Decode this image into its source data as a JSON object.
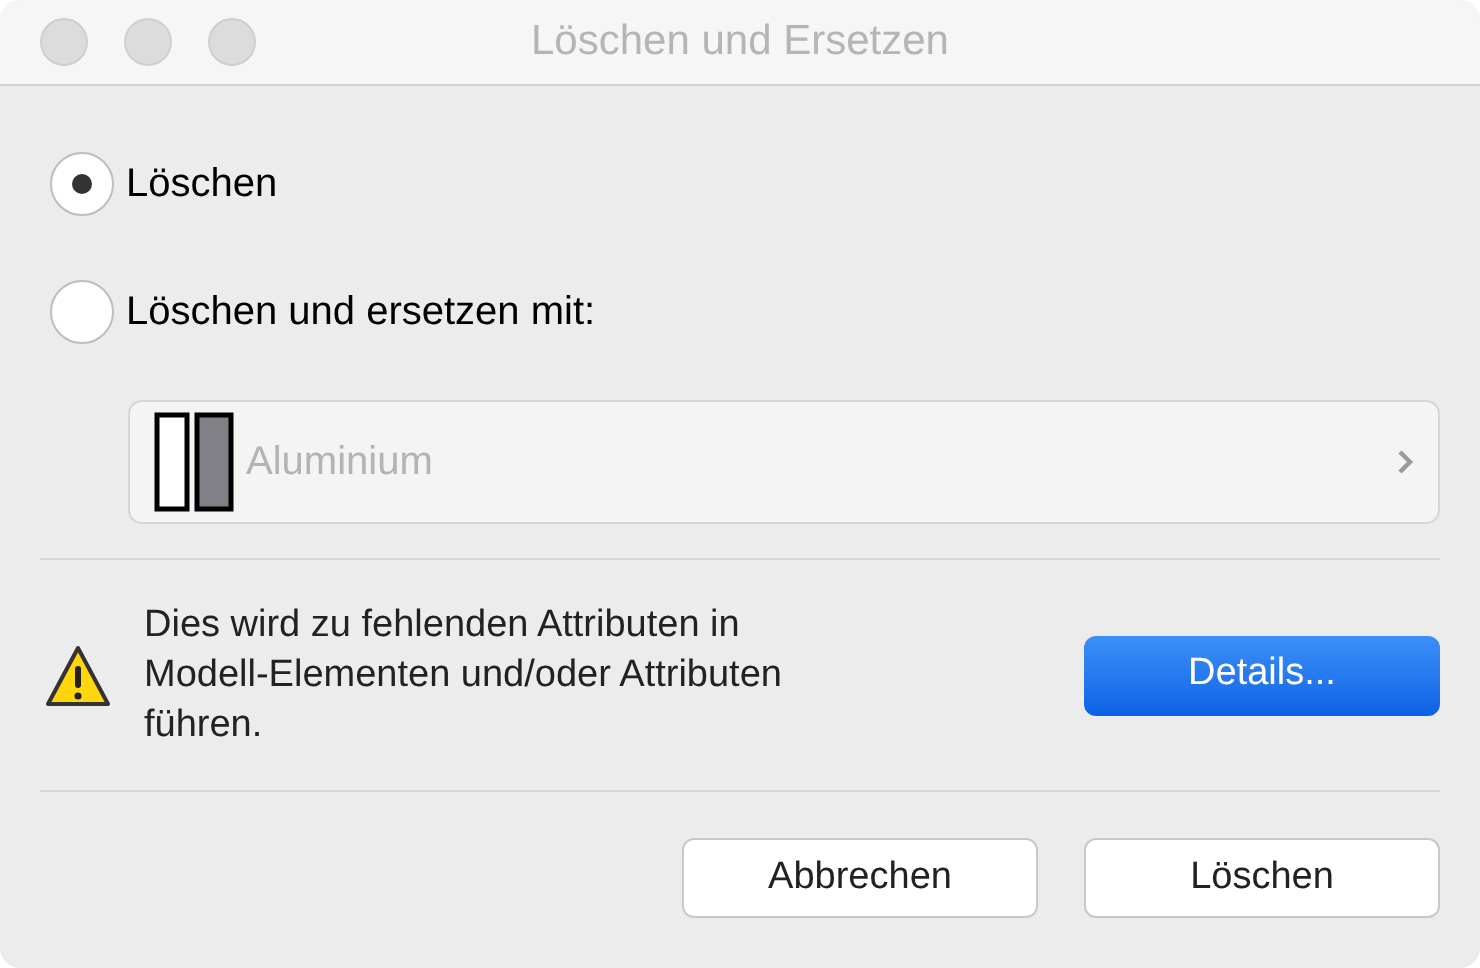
{
  "window": {
    "title": "Löschen und Ersetzen"
  },
  "options": [
    {
      "label": "Löschen",
      "selected": true
    },
    {
      "label": "Löschen und ersetzen mit:",
      "selected": false
    }
  ],
  "replacement_select": {
    "value": "Aluminium",
    "disabled": true
  },
  "warning": {
    "message": "Dies wird zu fehlenden Attributen in Modell-Elementen und/oder Attributen führen.",
    "button": "Details..."
  },
  "buttons": [
    {
      "label": "Abbrechen"
    },
    {
      "label": "Löschen"
    }
  ]
}
